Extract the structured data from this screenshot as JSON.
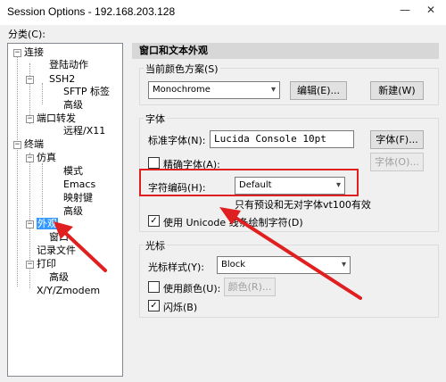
{
  "window": {
    "title": "Session Options - 192.168.203.128",
    "minimize_icon": "minimize-icon",
    "close_icon": "close-icon"
  },
  "category": {
    "label": "分类(C):",
    "tree": {
      "connect": "连接",
      "login_actions": "登陆动作",
      "ssh2": "SSH2",
      "sftp_tab": "SFTP 标签",
      "advanced_ssh": "高级",
      "port_forward": "端口转发",
      "remote_x11": "远程/X11",
      "terminal": "终端",
      "emulation": "仿真",
      "modes": "模式",
      "emacs": "Emacs",
      "mapped_keys": "映射键",
      "advanced_emu": "高级",
      "appearance": "外观",
      "window": "窗口",
      "log_file": "记录文件",
      "printing": "打印",
      "advanced_print": "高级",
      "xyzmodem": "X/Y/Zmodem"
    }
  },
  "panel": {
    "header": "窗口和文本外观",
    "color_scheme": {
      "label": "当前颜色方案(S)",
      "value": "Monochrome",
      "edit_button": "编辑(E)...",
      "new_button": "新建(W)"
    },
    "font": {
      "group_label": "字体",
      "normal_font_label": "标准字体(N):",
      "normal_font_value": "Lucida Console 10pt",
      "font_button": "字体(F)...",
      "precise_font_label": "精确字体(A):",
      "precise_font_button": "字体(O)...",
      "encoding_label": "字符编码(H):",
      "encoding_value": "Default",
      "note": "只有预设和无对字体vt100有效",
      "unicode_label": "使用 Unicode 线条绘制字符(D)",
      "unicode_checked": true
    },
    "cursor": {
      "group_label": "光标",
      "style_label": "光标样式(Y):",
      "style_value": "Block",
      "use_color_label": "使用颜色(U):",
      "color_button": "颜色(R)...",
      "blink_label": "闪烁(B)",
      "blink_checked": true
    }
  },
  "colors": {
    "annotation": "#e02020",
    "selection": "#3399ff",
    "header_bg": "#d7d7d7"
  }
}
